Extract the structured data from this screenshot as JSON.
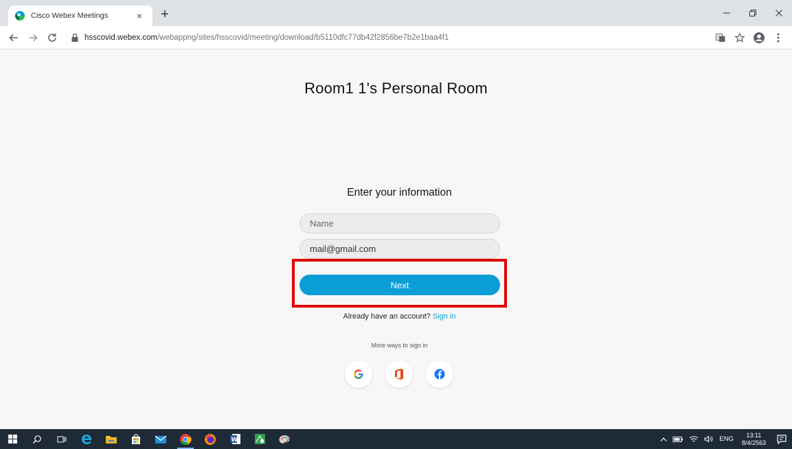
{
  "browser": {
    "tab_title": "Cisco Webex Meetings",
    "tab_close": "×",
    "new_tab": "+",
    "url_host": "hsscovid.webex.com",
    "url_path": "/webappng/sites/hsscovid/meeting/download/b5110dfc77db42f2856be7b2e1baa4f1"
  },
  "page": {
    "room_title": "Room1 1's Personal Room",
    "form_heading": "Enter your information",
    "name_placeholder": "Name",
    "email_value": "mail@gmail.com",
    "next_label": "Next",
    "account_prompt": "Already have an account?",
    "sign_in_label": "Sign in",
    "more_ways": "More ways to sign in",
    "social": [
      "google-icon",
      "office-icon",
      "facebook-icon"
    ]
  },
  "taskbar": {
    "language": "ENG",
    "time": "13:11",
    "date": "8/4/2563"
  },
  "colors": {
    "accent": "#0b9ed6",
    "highlight": "#e00000",
    "taskbar": "#1f2a37"
  }
}
